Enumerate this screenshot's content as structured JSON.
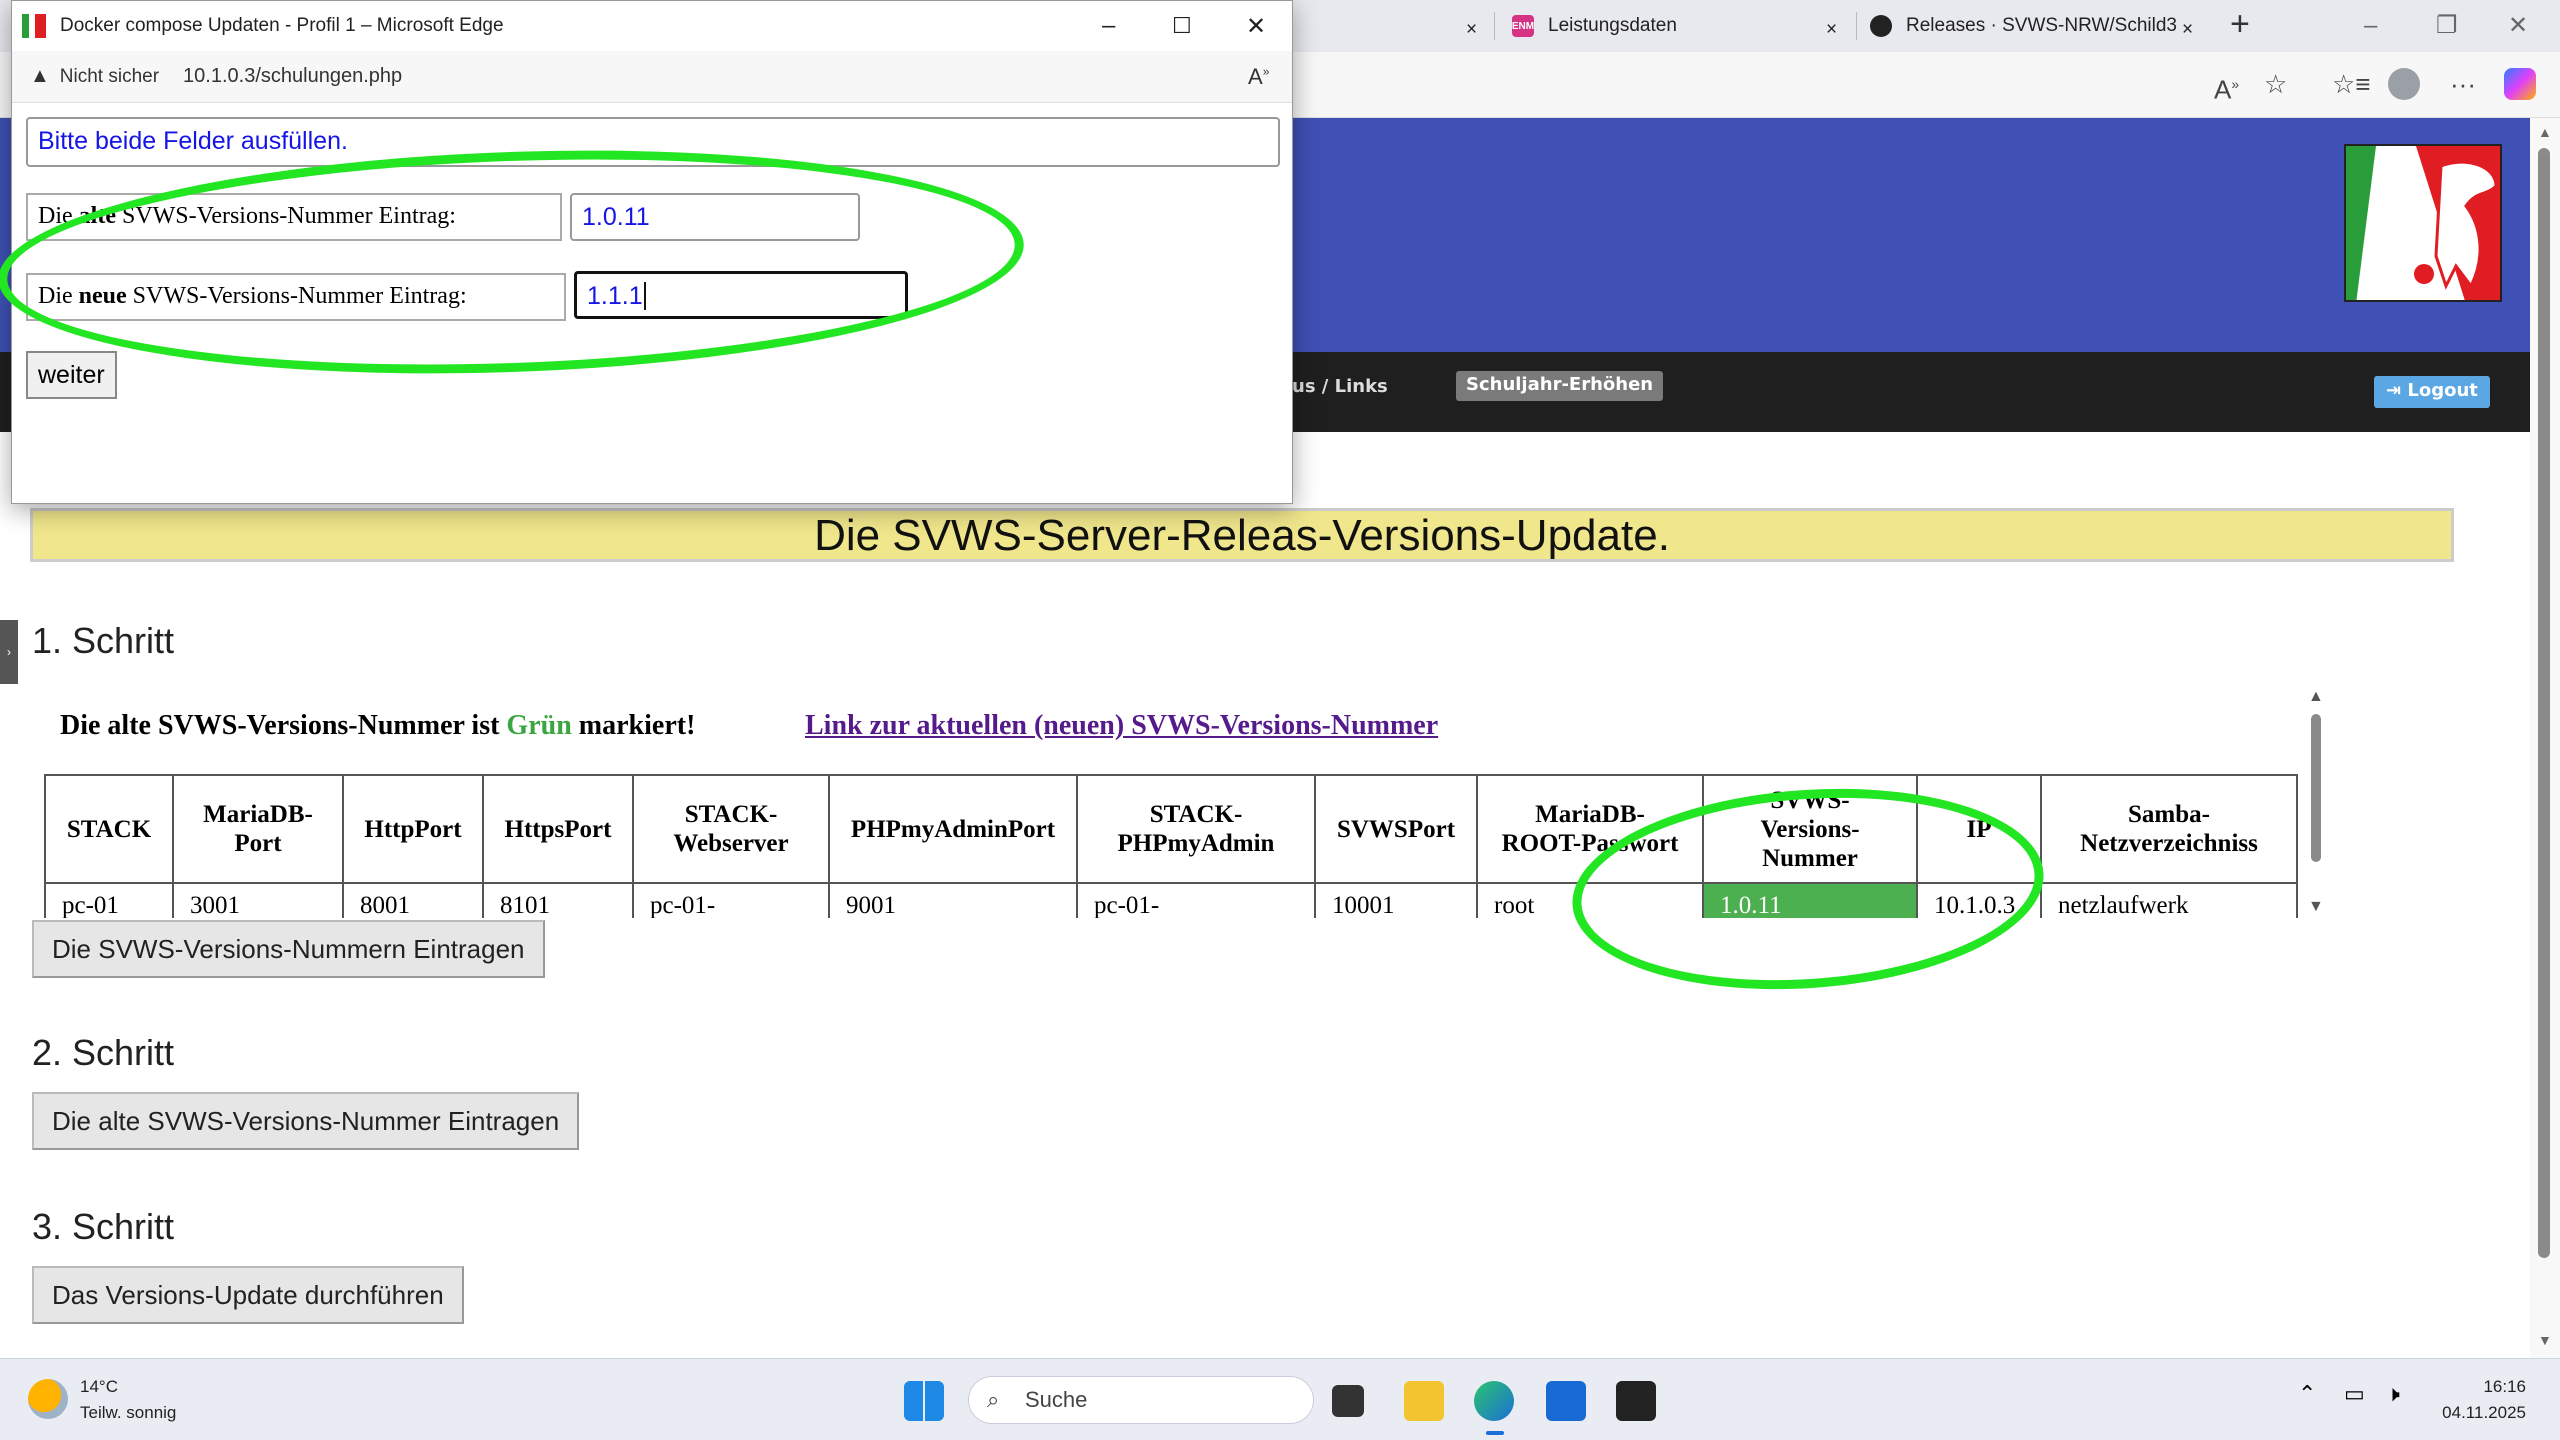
{
  "browser": {
    "tabs": [
      {
        "label": "Leistungsdaten",
        "favicon_text": "ENM",
        "color": "#d63384"
      },
      {
        "label": "Releases · SVWS-NRW/Schild3",
        "favicon_text": "",
        "color": "#222222"
      }
    ],
    "new_tab": "+"
  },
  "page": {
    "nav": {
      "partial_item": "us / Links",
      "item_schuljahr": "Schuljahr-Erhöhen",
      "logout": "Logout"
    },
    "title": "Die SVWS-Server-Releas-Versions-Update.",
    "step1": {
      "heading": "1. Schritt",
      "note_prefix": "Die alte SVWS-Versions-Nummer ist ",
      "note_green": "Grün",
      "note_suffix": " markiert!",
      "link": "Link zur aktuellen (neuen) SVWS-Versions-Nummer",
      "button": "Die SVWS-Versions-Nummern Eintragen"
    },
    "table": {
      "headers": [
        "STACK",
        "MariaDB-\nPort",
        "HttpPort",
        "HttpsPort",
        "STACK-\nWebserver",
        "PHPmyAdminPort",
        "STACK-\nPHPmyAdmin",
        "SVWSPort",
        "MariaDB-\nROOT-Passwort",
        "SVWS-\nVersions-\nNummer",
        "IP",
        "Samba-\nNetzverzeichniss"
      ],
      "rows": [
        [
          "pc-01",
          "3001",
          "8001",
          "8101",
          "pc-01-",
          "9001",
          "pc-01-",
          "10001",
          "root",
          "1.0.11",
          "10.1.0.3",
          "netzlaufwerk"
        ]
      ]
    },
    "step2": {
      "heading": "2. Schritt",
      "button": "Die alte SVWS-Versions-Nummer Eintragen"
    },
    "step3": {
      "heading": "3. Schritt",
      "button": "Das Versions-Update durchführen"
    }
  },
  "popup": {
    "title": "Docker compose Updaten - Profil 1 – Microsoft Edge",
    "security": "Nicht sicher",
    "url": "10.1.0.3/schulungen.php",
    "message": "Bitte beide Felder ausfüllen.",
    "old_label_prefix": "Die ",
    "old_label_bold": "alte",
    "old_label_suffix": "  SVWS-Versions-Nummer Eintrag:",
    "old_value": "1.0.11",
    "new_label_prefix": "Die ",
    "new_label_bold": "neue",
    "new_label_suffix": " SVWS-Versions-Nummer Eintrag:",
    "new_value": "1.1.1",
    "button": "weiter"
  },
  "taskbar": {
    "weather_temp": "14°C",
    "weather_desc": "Teilw. sonnig",
    "search_placeholder": "Suche",
    "time": "16:16",
    "date": "04.11.2025"
  }
}
